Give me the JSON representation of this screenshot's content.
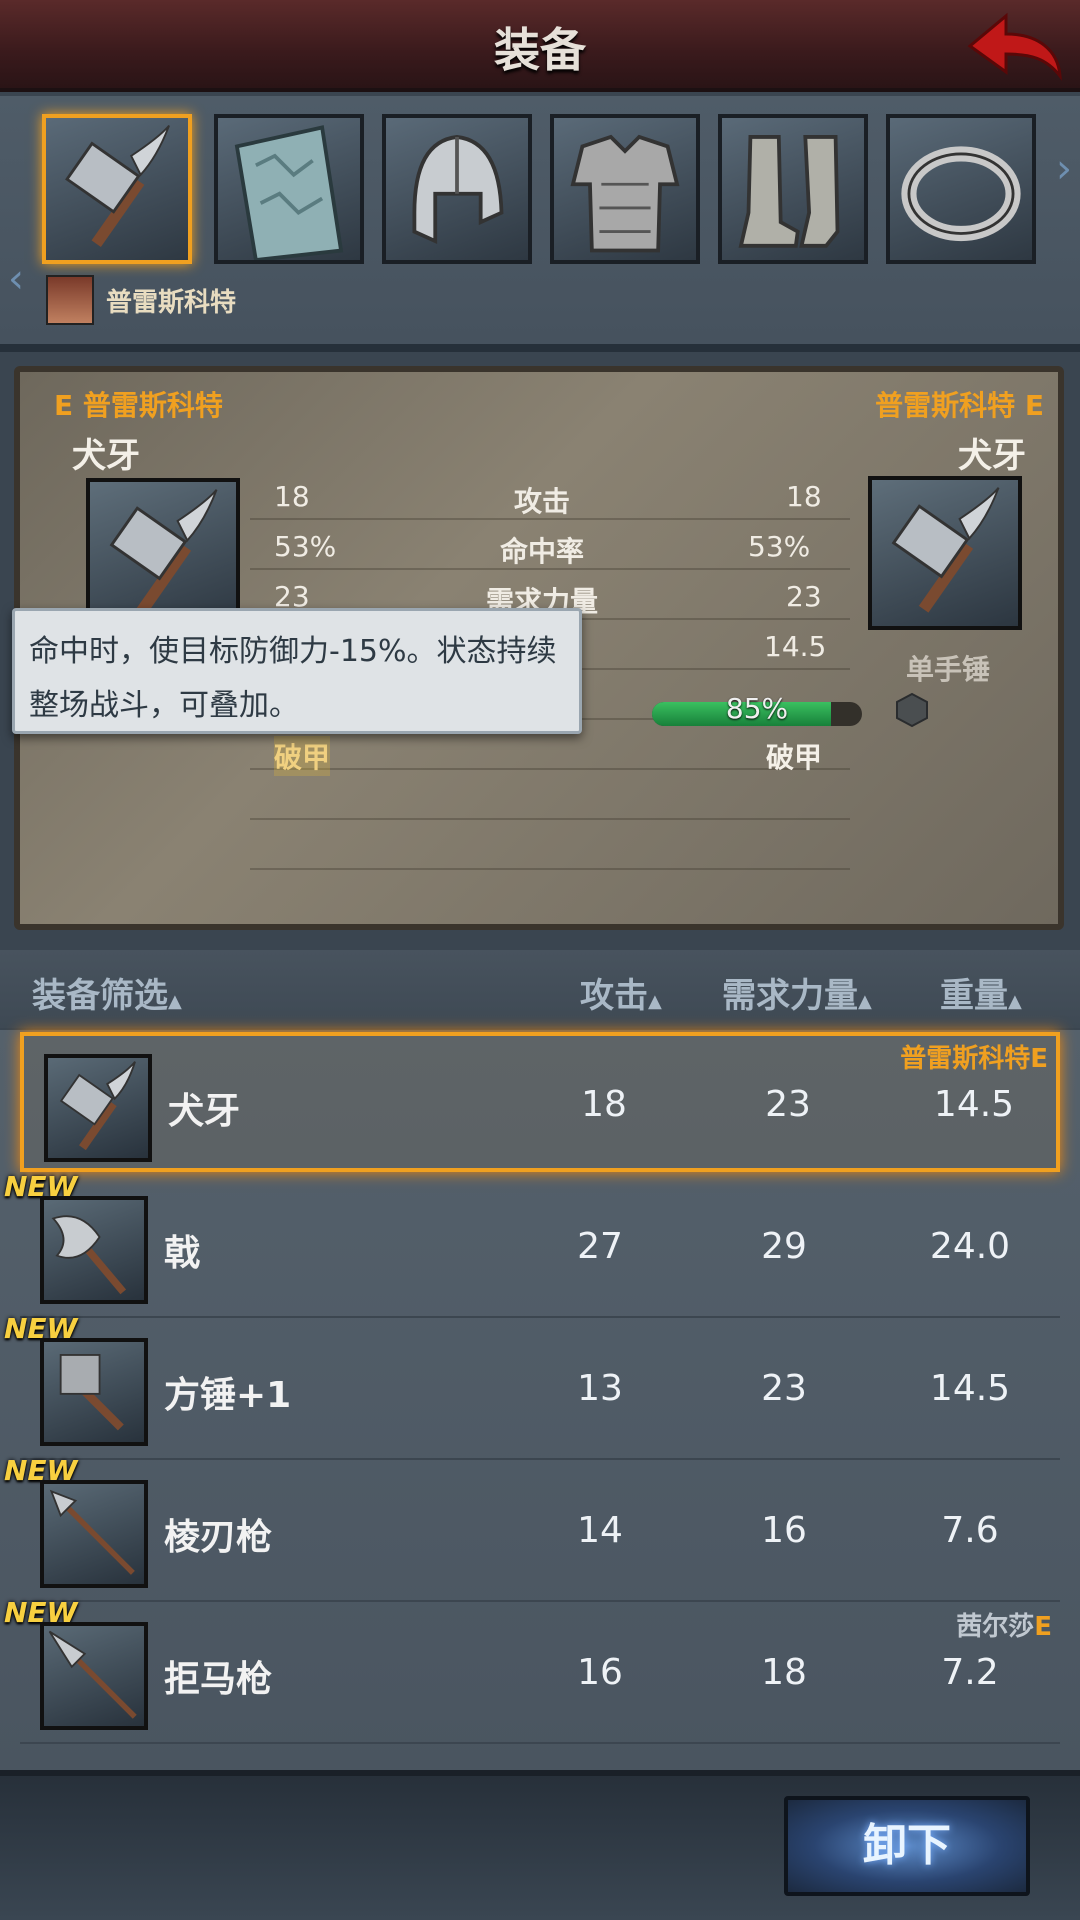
{
  "header": {
    "title": "装备"
  },
  "owner": {
    "name": "普雷斯科特"
  },
  "slots": [
    "hammer-icon",
    "shield-icon",
    "helmet-icon",
    "armor-icon",
    "boots-icon",
    "ring-icon"
  ],
  "compare": {
    "left": {
      "owner": "E 普雷斯科特",
      "item": "犬牙"
    },
    "right": {
      "owner": "普雷斯科特 E",
      "item": "犬牙",
      "type": "单手锤"
    },
    "stats": [
      {
        "label": "攻击",
        "left": "18",
        "right": "18"
      },
      {
        "label": "命中率",
        "left": "53%",
        "right": "53%"
      },
      {
        "label": "需求力量",
        "left": "23",
        "right": "23"
      },
      {
        "label": "",
        "left": "",
        "right": "14.5"
      }
    ],
    "durability": {
      "text": "85%",
      "value": 0.85
    },
    "armor_break_left": "破甲",
    "armor_break_right": "破甲",
    "tooltip": "命中时，使目标防御力-15%。状态持续整场战斗，可叠加。"
  },
  "list_header": {
    "filter": "装备筛选",
    "attack": "攻击",
    "strength": "需求力量",
    "weight": "重量"
  },
  "items": [
    {
      "name": "犬牙",
      "attack": "18",
      "strength": "23",
      "weight": "14.5",
      "owner": "普雷斯科特E",
      "new": "",
      "icon": "hammer-icon"
    },
    {
      "name": "戟",
      "attack": "27",
      "strength": "29",
      "weight": "24.0",
      "owner": "",
      "new": "NEW",
      "icon": "halberd-icon"
    },
    {
      "name": "方锤+1",
      "attack": "13",
      "strength": "23",
      "weight": "14.5",
      "owner": "",
      "new": "NEW",
      "icon": "square-hammer-icon"
    },
    {
      "name": "棱刃枪",
      "attack": "14",
      "strength": "16",
      "weight": "7.6",
      "owner": "",
      "new": "NEW",
      "icon": "spear-icon"
    },
    {
      "name": "拒马枪",
      "attack": "16",
      "strength": "18",
      "weight": "7.2",
      "owner": "茜尔莎",
      "owner_suffix": "E",
      "new": "NEW",
      "icon": "pike-icon"
    }
  ],
  "bottom": {
    "unequip": "卸下"
  },
  "colors": {
    "accent": "#f0a020",
    "new": "#f8d040",
    "button": "#2a4470"
  }
}
